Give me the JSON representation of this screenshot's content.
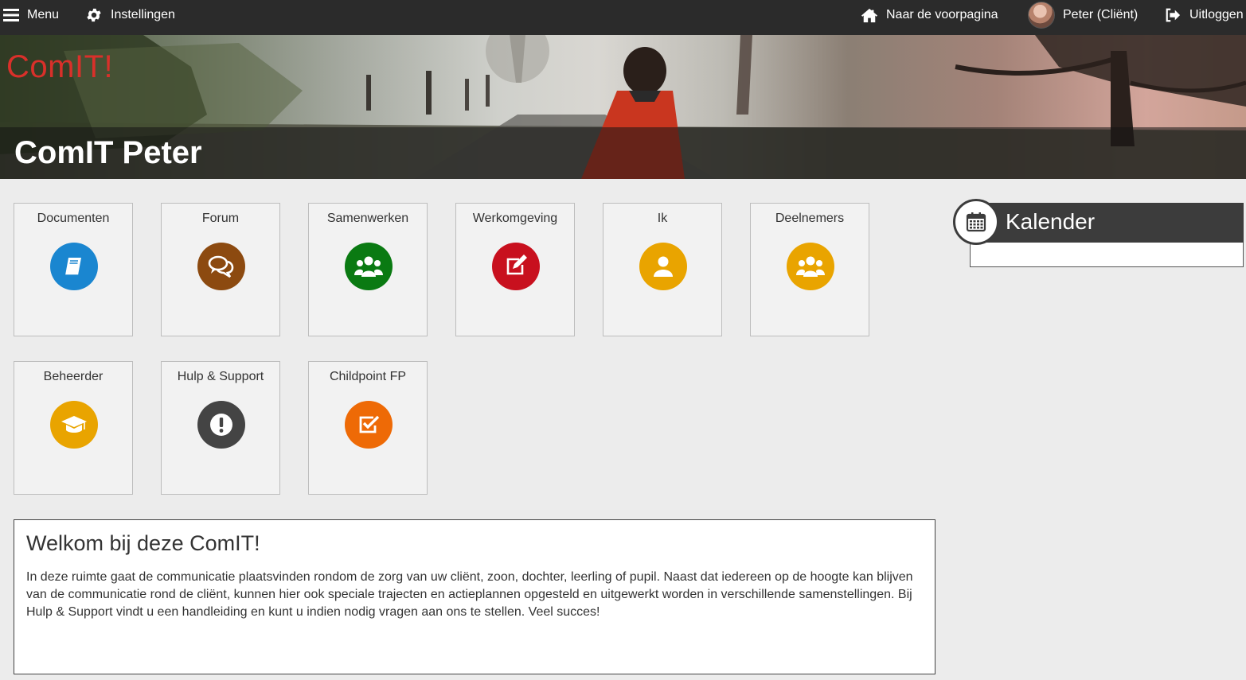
{
  "topbar": {
    "menu_label": "Menu",
    "settings_label": "Instellingen",
    "home_label": "Naar de voorpagina",
    "user_label": "Peter (Cliënt)",
    "logout_label": "Uitloggen"
  },
  "banner": {
    "brand": "ComIT!",
    "title": "ComIT Peter"
  },
  "tiles": [
    {
      "label": "Documenten",
      "icon": "book-icon",
      "color": "#1a86d0"
    },
    {
      "label": "Forum",
      "icon": "chat-icon",
      "color": "#8c4a10"
    },
    {
      "label": "Samenwerken",
      "icon": "group-icon",
      "color": "#0a7a12"
    },
    {
      "label": "Werkomgeving",
      "icon": "edit-icon",
      "color": "#c8101e"
    },
    {
      "label": "Ik",
      "icon": "user-icon",
      "color": "#e9a400"
    },
    {
      "label": "Deelnemers",
      "icon": "group-icon",
      "color": "#e9a400"
    },
    {
      "label": "Beheerder",
      "icon": "graduation-cap-icon",
      "color": "#e9a400"
    },
    {
      "label": "Hulp & Support",
      "icon": "exclamation-icon",
      "color": "#444444"
    },
    {
      "label": "Childpoint FP",
      "icon": "checkbox-icon",
      "color": "#ee6a06"
    }
  ],
  "welcome": {
    "title": "Welkom bij deze ComIT!",
    "text": "In deze ruimte gaat de communicatie plaatsvinden rondom de zorg van uw cliënt, zoon, dochter, leerling of pupil. Naast dat iedereen op de hoogte kan blijven van de communicatie rond de cliënt, kunnen hier ook speciale trajecten en actieplannen opgesteld en uitgewerkt worden in verschillende samenstellingen. Bij Hulp & Support vindt u een handleiding en kunt u indien nodig vragen aan ons te stellen. Veel succes!"
  },
  "calendar": {
    "title": "Kalender",
    "icon": "calendar-icon"
  },
  "colors": {
    "topbar": "#2b2b2b",
    "brand": "#d9302a",
    "page_background": "#ececec"
  }
}
